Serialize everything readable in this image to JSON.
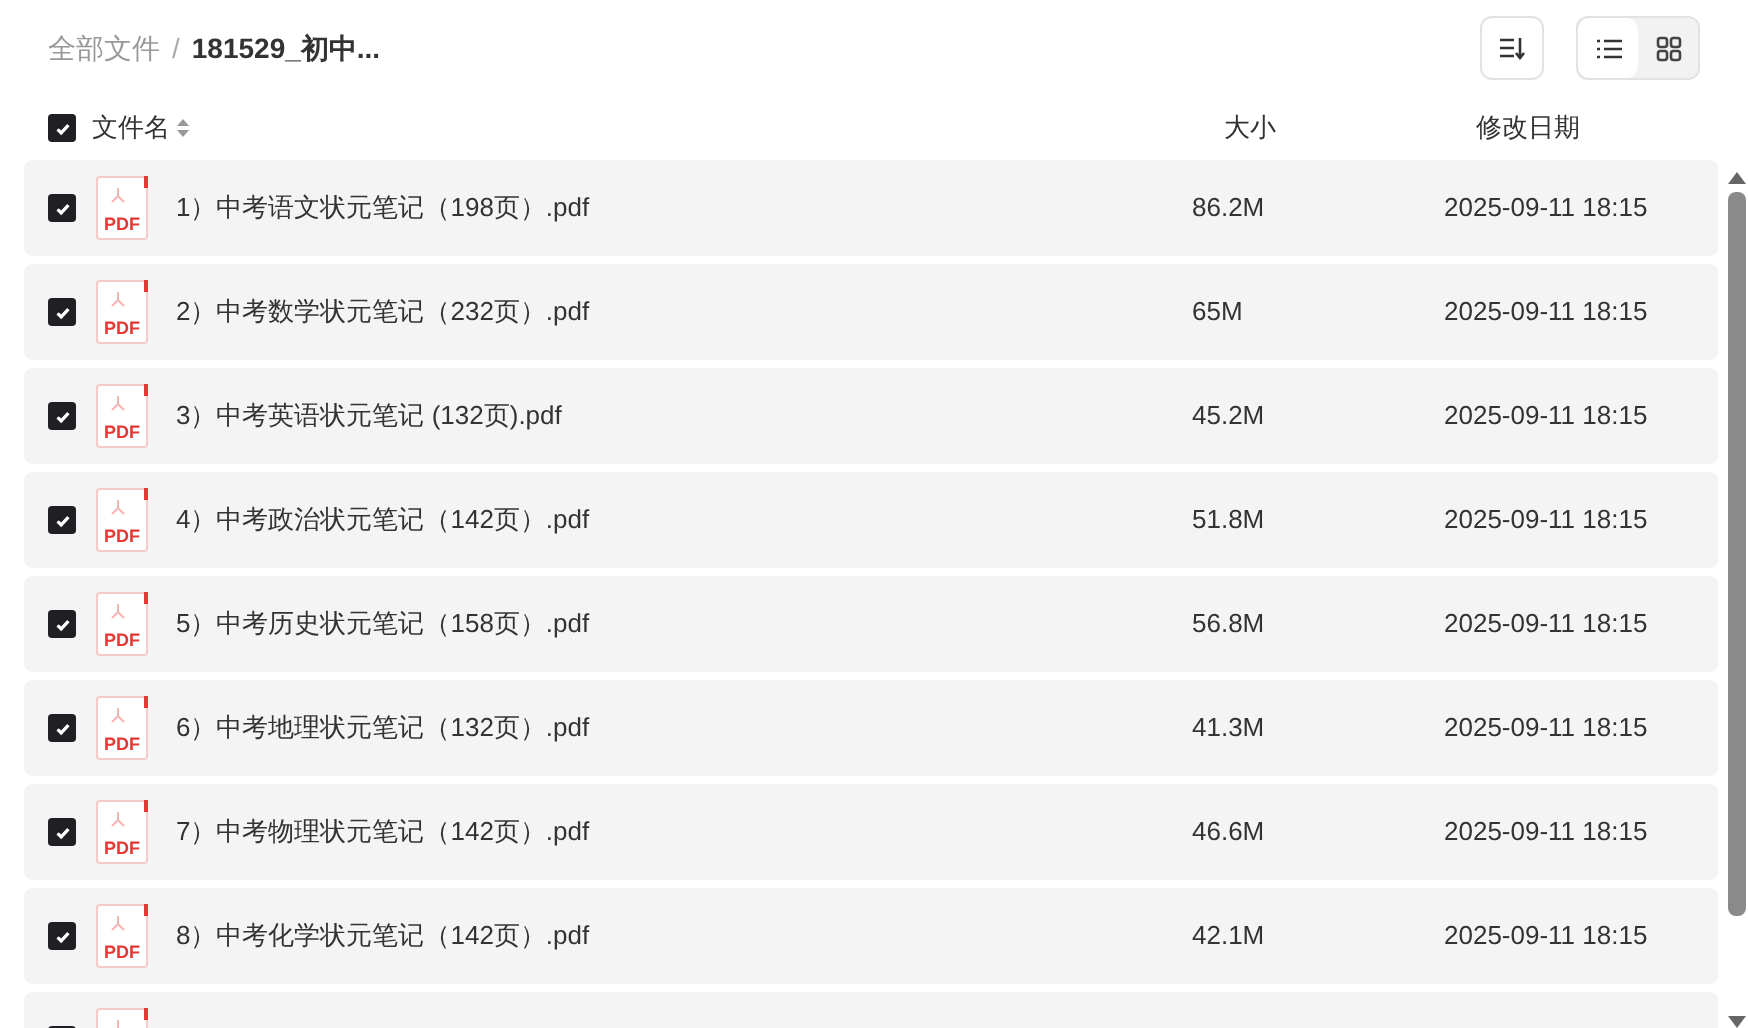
{
  "breadcrumb_separator": "/",
  "breadcrumb": [
    {
      "label": "全部文件",
      "current": false
    },
    {
      "label": "181529_初中...",
      "current": true
    }
  ],
  "toolbar": {
    "view_modes": [
      {
        "kind": "list",
        "selected": true
      },
      {
        "kind": "grid",
        "selected": false
      }
    ]
  },
  "header": {
    "all_checked": true,
    "columns": [
      "文件名",
      "大小",
      "修改日期"
    ]
  },
  "rows": [
    {
      "checked": true,
      "type_label": "PDF",
      "name": "1）中考语文状元笔记（198页）.pdf",
      "size": "86.2M",
      "date": "2025-09-11 18:15"
    },
    {
      "checked": true,
      "type_label": "PDF",
      "name": "2）中考数学状元笔记（232页）.pdf",
      "size": "65M",
      "date": "2025-09-11 18:15"
    },
    {
      "checked": true,
      "type_label": "PDF",
      "name": "3）中考英语状元笔记 (132页).pdf",
      "size": "45.2M",
      "date": "2025-09-11 18:15"
    },
    {
      "checked": true,
      "type_label": "PDF",
      "name": "4）中考政治状元笔记（142页）.pdf",
      "size": "51.8M",
      "date": "2025-09-11 18:15"
    },
    {
      "checked": true,
      "type_label": "PDF",
      "name": "5）中考历史状元笔记（158页）.pdf",
      "size": "56.8M",
      "date": "2025-09-11 18:15"
    },
    {
      "checked": true,
      "type_label": "PDF",
      "name": "6）中考地理状元笔记（132页）.pdf",
      "size": "41.3M",
      "date": "2025-09-11 18:15"
    },
    {
      "checked": true,
      "type_label": "PDF",
      "name": "7）中考物理状元笔记（142页）.pdf",
      "size": "46.6M",
      "date": "2025-09-11 18:15"
    },
    {
      "checked": true,
      "type_label": "PDF",
      "name": "8）中考化学状元笔记（142页）.pdf",
      "size": "42.1M",
      "date": "2025-09-11 18:15"
    },
    {
      "checked": true
    }
  ]
}
